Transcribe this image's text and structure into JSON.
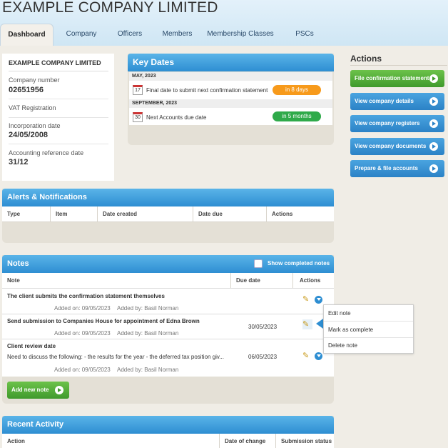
{
  "header": {
    "title": "EXAMPLE COMPANY LIMITED"
  },
  "tabs": [
    "Dashboard",
    "Company",
    "Officers",
    "Members",
    "Membership Classes",
    "PSCs"
  ],
  "company_card": {
    "name": "EXAMPLE COMPANY LIMITED",
    "fields": [
      {
        "label": "Company number",
        "value": "02651956"
      },
      {
        "label": "VAT Registration",
        "value": ""
      },
      {
        "label": "Incorporation date",
        "value": "24/05/2008"
      },
      {
        "label": "Accounting reference date",
        "value": "31/12"
      }
    ]
  },
  "key_dates": {
    "title": "Key Dates",
    "groups": [
      {
        "month": "MAY, 2023",
        "day": "17",
        "text": "Final date to submit next confirmation statement",
        "badge": "in 8 days",
        "badge_color": "#f79a1b"
      },
      {
        "month": "SEPTEMBER, 2023",
        "day": "30",
        "text": "Next Accounts due date",
        "badge": "in 5 months",
        "badge_color": "#2faa4a"
      }
    ]
  },
  "actions": {
    "title": "Actions",
    "buttons": [
      "File confirmation statement",
      "View company details",
      "View company registers",
      "View company documents",
      "Prepare & file accounts"
    ]
  },
  "alerts": {
    "title": "Alerts & Notifications",
    "columns": [
      "Type",
      "Item",
      "Date created",
      "Date due",
      "Actions"
    ]
  },
  "notes": {
    "title": "Notes",
    "show_completed": "Show completed notes",
    "columns": [
      "Note",
      "Due date",
      "Actions"
    ],
    "rows": [
      {
        "title": "The client submits the confirmation statement themselves",
        "body": "",
        "due": "",
        "added_on": "Added on: 09/05/2023",
        "added_by": "Added by: Basil Norman"
      },
      {
        "title": "Send submission to Companies House for appointment of Edna Brown",
        "body": "",
        "due": "30/05/2023",
        "added_on": "Added on: 09/05/2023",
        "added_by": "Added by: Basil Norman"
      },
      {
        "title": "Client review date",
        "body": "Need to discuss the following: - the results for the year - the deferred tax position giv...",
        "due": "06/05/2023",
        "added_on": "Added on: 09/05/2023",
        "added_by": "Added by: Basil Norman"
      }
    ],
    "add_button": "Add new note"
  },
  "context_menu": [
    "Edit note",
    "Mark as complete",
    "Delete note"
  ],
  "recent": {
    "title": "Recent Activity",
    "columns": [
      "Action",
      "Date of change",
      "Submission status"
    ]
  }
}
